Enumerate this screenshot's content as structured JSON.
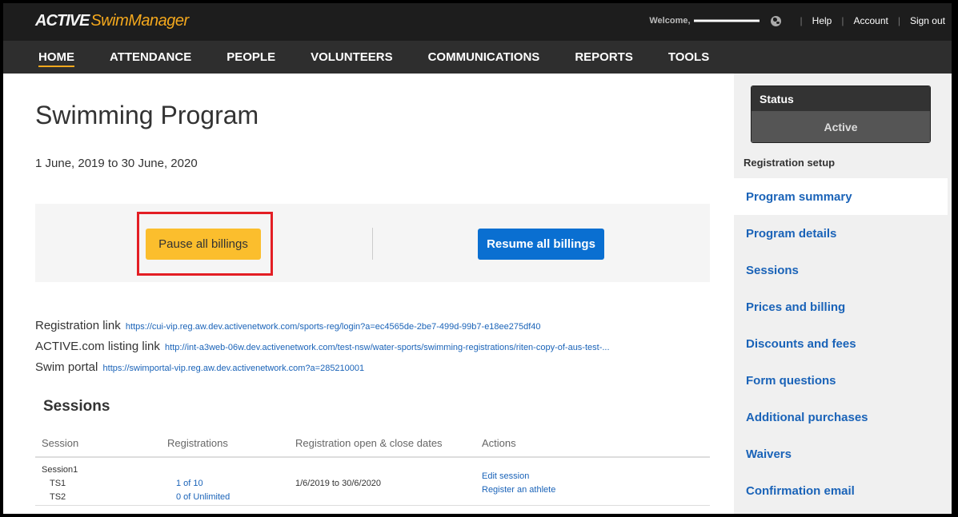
{
  "header": {
    "logo_active": "ACTIVE",
    "logo_swim": "SwimManager",
    "welcome": "Welcome,",
    "links": [
      "Help",
      "Account",
      "Sign out"
    ]
  },
  "nav": {
    "items": [
      "HOME",
      "ATTENDANCE",
      "PEOPLE",
      "VOLUNTEERS",
      "COMMUNICATIONS",
      "REPORTS",
      "TOOLS"
    ],
    "active": "HOME"
  },
  "main": {
    "title": "Swimming Program",
    "dates": "1 June, 2019 to 30 June, 2020",
    "pause_label": "Pause all billings",
    "resume_label": "Resume all billings",
    "links": [
      {
        "label": "Registration link",
        "url": "https://cui-vip.reg.aw.dev.activenetwork.com/sports-reg/login?a=ec4565de-2be7-499d-99b7-e18ee275df40"
      },
      {
        "label": "ACTIVE.com listing link",
        "url": "http://int-a3web-06w.dev.activenetwork.com/test-nsw/water-sports/swimming-registrations/riten-copy-of-aus-test-..."
      },
      {
        "label": "Swim portal",
        "url": "https://swimportal-vip.reg.aw.dev.activenetwork.com?a=285210001"
      }
    ],
    "sessions": {
      "title": "Sessions",
      "columns": [
        "Session",
        "Registrations",
        "Registration open & close dates",
        "Actions"
      ],
      "rows": [
        {
          "name": "Session1",
          "subs": [
            "TS1",
            "TS2"
          ],
          "registrations": [
            "1 of 10",
            "0 of Unlimited"
          ],
          "dates": "1/6/2019 to 30/6/2020",
          "actions": [
            "Edit session",
            "Register an athlete"
          ]
        }
      ]
    }
  },
  "sidebar": {
    "status_label": "Status",
    "status_value": "Active",
    "section_title": "Registration setup",
    "items": [
      "Program summary",
      "Program details",
      "Sessions",
      "Prices and billing",
      "Discounts and fees",
      "Form questions",
      "Additional purchases",
      "Waivers",
      "Confirmation email"
    ],
    "selected": "Program summary"
  },
  "colors": {
    "accent": "#f4a81d",
    "pause_button": "#fbbe2d",
    "resume_button": "#0a6fd1",
    "link": "#1a63b8",
    "highlight": "#e31e24"
  }
}
